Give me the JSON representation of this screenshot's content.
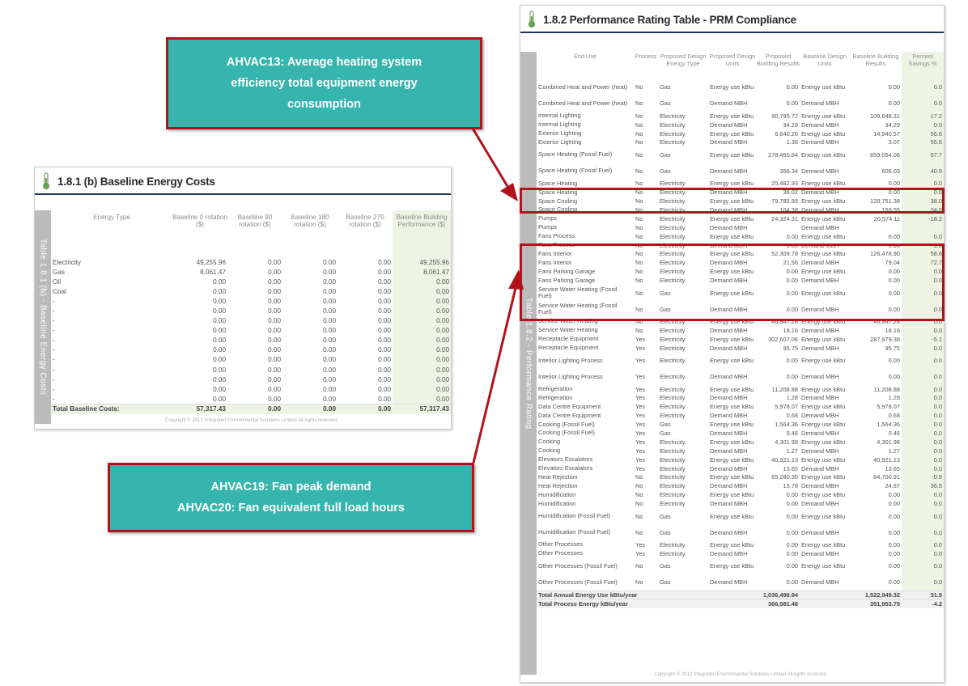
{
  "baseline_panel": {
    "title": "1.8.1 (b) Baseline Energy Costs",
    "side_tab": "Table 1.8.1 (b) - Baseline Energy Costs",
    "headers": [
      "Energy Type",
      "Baseline 0 rotation ($)",
      "Baseline 90 rotation ($)",
      "Baseline 180 rotation ($)",
      "Baseline 270 rotation ($)",
      "Baseline Building Performance ($)"
    ],
    "rows": [
      [
        "Electricity",
        "49,255.96",
        "0.00",
        "0.00",
        "0.00",
        "49,255.96"
      ],
      [
        "Gas",
        "8,061.47",
        "0.00",
        "0.00",
        "0.00",
        "8,061.47"
      ],
      [
        "Oil",
        "0.00",
        "0.00",
        "0.00",
        "0.00",
        "0.00"
      ],
      [
        "Coal",
        "0.00",
        "0.00",
        "0.00",
        "0.00",
        "0.00"
      ],
      [
        "-",
        "0.00",
        "0.00",
        "0.00",
        "0.00",
        "0.00"
      ],
      [
        "-",
        "0.00",
        "0.00",
        "0.00",
        "0.00",
        "0.00"
      ],
      [
        "-",
        "0.00",
        "0.00",
        "0.00",
        "0.00",
        "0.00"
      ],
      [
        "-",
        "0.00",
        "0.00",
        "0.00",
        "0.00",
        "0.00"
      ],
      [
        "-",
        "0.00",
        "0.00",
        "0.00",
        "0.00",
        "0.00"
      ],
      [
        "-",
        "0.00",
        "0.00",
        "0.00",
        "0.00",
        "0.00"
      ],
      [
        "-",
        "0.00",
        "0.00",
        "0.00",
        "0.00",
        "0.00"
      ],
      [
        "-",
        "0.00",
        "0.00",
        "0.00",
        "0.00",
        "0.00"
      ],
      [
        "-",
        "0.00",
        "0.00",
        "0.00",
        "0.00",
        "0.00"
      ],
      [
        "-",
        "0.00",
        "0.00",
        "0.00",
        "0.00",
        "0.00"
      ],
      [
        "-",
        "0.00",
        "0.00",
        "0.00",
        "0.00",
        "0.00"
      ]
    ],
    "total": [
      "Total Baseline Costs:",
      "57,317.43",
      "0.00",
      "0.00",
      "0.00",
      "57,317.43"
    ],
    "copyright": "Copyright © 2012 Integrated Environmental Solutions Limited All rights reserved"
  },
  "prm_panel": {
    "title": "1.8.2 Performance Rating Table - PRM Compliance",
    "side_tab": "Table 1.8.2 - Performance Rating",
    "headers": [
      "End Use",
      "Process",
      "Proposed Design Energy Type",
      "Proposed Design Units",
      "Proposed Building Results",
      "Baseline Design Units",
      "Baseline Building Results",
      "Percent Savings %"
    ],
    "rows": [
      [
        "Combined Heat and Power (heat)",
        "No",
        "Gas",
        "Energy use kBtu",
        "0.00",
        "Energy use kBtu",
        "0.00",
        "0.0"
      ],
      [
        "Combined Heat and Power (heat)",
        "No",
        "Gas",
        "Demand MBH",
        "0.00",
        "Demand MBH",
        "0.00",
        "0.0"
      ],
      [
        "Internal Lighting",
        "No",
        "Electricity",
        "Energy use kBtu",
        "90,795.72",
        "Energy use kBtu",
        "109,648.31",
        "17.2"
      ],
      [
        "Internal Lighting",
        "No",
        "Electricity",
        "Demand MBH",
        "34.29",
        "Demand MBH",
        "34.29",
        "0.0"
      ],
      [
        "Exterior Lighting",
        "No",
        "Electricity",
        "Energy use kBtu",
        "6,640.26",
        "Energy use kBtu",
        "14,940.57",
        "55.6"
      ],
      [
        "Exterior Lighting",
        "No",
        "Electricity",
        "Demand MBH",
        "1.36",
        "Demand MBH",
        "3.07",
        "55.6"
      ],
      [
        "Space Heating (Fossil Fuel)",
        "No",
        "Gas",
        "Energy use kBtu",
        "278,450.84",
        "Energy use kBtu",
        "659,054.06",
        "57.7"
      ],
      [
        "Space Heating (Fossil Fuel)",
        "No",
        "Gas",
        "Demand MBH",
        "358.34",
        "Demand MBH",
        "606.03",
        "40.9"
      ],
      [
        "Space Heating",
        "No",
        "Electricity",
        "Energy use kBtu",
        "25,482.93",
        "Energy use kBtu",
        "0.00",
        "0.0"
      ],
      [
        "Space Heating",
        "No",
        "Electricity",
        "Demand MBH",
        "36.02",
        "Demand MBH",
        "0.00",
        "0.0"
      ],
      [
        "Space Cooling",
        "No",
        "Electricity",
        "Energy use kBtu",
        "79,785.99",
        "Energy use kBtu",
        "128,751.38",
        "38.0"
      ],
      [
        "Space Cooling",
        "No",
        "Electricity",
        "Demand MBH",
        "104.38",
        "Demand MBH",
        "159.55",
        "34.6"
      ],
      [
        "Pumps",
        "No",
        "Electricity",
        "Energy use kBtu",
        "24,324.31",
        "Energy use kBtu",
        "20,574.11",
        "-18.2"
      ],
      [
        "Pumps",
        "No",
        "Electricity",
        "Demand MBH",
        "",
        "Demand MBH",
        "",
        ""
      ],
      [
        "Fans Process",
        "No",
        "Electricity",
        "Energy use kBtu",
        "0.00",
        "Energy use kBtu",
        "0.00",
        "0.0"
      ],
      [
        "Fans Process",
        "No",
        "Electricity",
        "Demand MBH",
        "0.00",
        "Demand MBH",
        "0.00",
        "0.0"
      ],
      [
        "Fans Interior",
        "No",
        "Electricity",
        "Energy use kBtu",
        "52,309.78",
        "Energy use kBtu",
        "126,478.90",
        "58.6"
      ],
      [
        "Fans Interior",
        "No",
        "Electricity",
        "Demand MBH",
        "21.56",
        "Demand MBH",
        "79.04",
        "72.7"
      ],
      [
        "Fans Parking Garage",
        "No",
        "Electricity",
        "Energy use kBtu",
        "0.00",
        "Energy use kBtu",
        "0.00",
        "0.0"
      ],
      [
        "Fans Parking Garage",
        "No",
        "Electricity",
        "Demand MBH",
        "0.00",
        "Demand MBH",
        "0.00",
        "0.0"
      ],
      [
        "Service Water Heating (Fossil Fuel)",
        "No",
        "Gas",
        "Energy use kBtu",
        "0.00",
        "Energy use kBtu",
        "0.00",
        "0.0"
      ],
      [
        "Service Water Heating (Fossil Fuel)",
        "No",
        "Gas",
        "Demand MBH",
        "0.00",
        "Demand MBH",
        "0.00",
        "0.0"
      ],
      [
        "Service Water Heating",
        "No",
        "Electricity",
        "Energy use kBtu",
        "46,847.28",
        "Energy use kBtu",
        "46,847.28",
        "0.0"
      ],
      [
        "Service Water Heating",
        "No",
        "Electricity",
        "Demand MBH",
        "18.16",
        "Demand MBH",
        "18.16",
        "0.0"
      ],
      [
        "Receptacle Equipment",
        "Yes",
        "Electricity",
        "Energy use kBtu",
        "302,607.06",
        "Energy use kBtu",
        "287,979.38",
        "-5.1"
      ],
      [
        "Receptacle Equipment",
        "Yes",
        "Electricity",
        "Demand MBH",
        "95.75",
        "Demand MBH",
        "95.75",
        "0.0"
      ],
      [
        "Interior Lighting Process",
        "Yes",
        "Electricity",
        "Energy use kBtu",
        "0.00",
        "Energy use kBtu",
        "0.00",
        "0.0"
      ],
      [
        "Interior Lighting Process",
        "Yes",
        "Electricity",
        "Demand MBH",
        "0.00",
        "Demand MBH",
        "0.00",
        "0.0"
      ],
      [
        "Refrigeration",
        "Yes",
        "Electricity",
        "Energy use kBtu",
        "11,208.88",
        "Energy use kBtu",
        "11,208.88",
        "0.0"
      ],
      [
        "Refrigeration",
        "Yes",
        "Electricity",
        "Demand MBH",
        "1.28",
        "Demand MBH",
        "1.28",
        "0.0"
      ],
      [
        "Data Centre Equipment",
        "Yes",
        "Electricity",
        "Energy use kBtu",
        "5,978.07",
        "Energy use kBtu",
        "5,978.07",
        "0.0"
      ],
      [
        "Data Centre Equipment",
        "Yes",
        "Electricity",
        "Demand MBH",
        "0.68",
        "Demand MBH",
        "0.68",
        "0.0"
      ],
      [
        "Cooking (Fossil Fuel)",
        "Yes",
        "Gas",
        "Energy use kBtu",
        "1,564.36",
        "Energy use kBtu",
        "1,564.36",
        "0.0"
      ],
      [
        "Cooking (Fossil Fuel)",
        "Yes",
        "Gas",
        "Demand MBH",
        "0.46",
        "Demand MBH",
        "0.46",
        "0.0"
      ],
      [
        "Cooking",
        "Yes",
        "Electricity",
        "Energy use kBtu",
        "4,301.98",
        "Energy use kBtu",
        "4,301.98",
        "0.0"
      ],
      [
        "Cooking",
        "Yes",
        "Electricity",
        "Demand MBH",
        "1.27",
        "Demand MBH",
        "1.27",
        "0.0"
      ],
      [
        "Elevators Escalators",
        "Yes",
        "Electricity",
        "Energy use kBtu",
        "40,921.13",
        "Energy use kBtu",
        "40,921.13",
        "0.0"
      ],
      [
        "Elevators Escalators",
        "Yes",
        "Electricity",
        "Demand MBH",
        "13.65",
        "Demand MBH",
        "13.65",
        "0.0"
      ],
      [
        "Heat Rejection",
        "No",
        "Electricity",
        "Energy use kBtu",
        "65,280.35",
        "Energy use kBtu",
        "64,700.91",
        "-0.9"
      ],
      [
        "Heat Rejection",
        "No",
        "Electricity",
        "Demand MBH",
        "15.78",
        "Demand MBH",
        "24.87",
        "36.5"
      ],
      [
        "Humidification",
        "No",
        "Electricity",
        "Energy use kBtu",
        "0.00",
        "Energy use kBtu",
        "0.00",
        "0.0"
      ],
      [
        "Humidification",
        "No",
        "Electricity",
        "Demand MBH",
        "0.00",
        "Demand MBH",
        "0.00",
        "0.0"
      ],
      [
        "Humidification (Fossil Fuel)",
        "No",
        "Gas",
        "Energy use kBtu",
        "0.00",
        "Energy use kBtu",
        "0.00",
        "0.0"
      ],
      [
        "Humidification (Fossil Fuel)",
        "No",
        "Gas",
        "Demand MBH",
        "0.00",
        "Demand MBH",
        "0.00",
        "0.0"
      ],
      [
        "Other Processes",
        "Yes",
        "Electricity",
        "Energy use kBtu",
        "0.00",
        "Energy use kBtu",
        "0.00",
        "0.0"
      ],
      [
        "Other Processes",
        "Yes",
        "Electricity",
        "Demand MBH",
        "0.00",
        "Demand MBH",
        "0.00",
        "0.0"
      ],
      [
        "Other Processes (Fossil Fuel)",
        "No",
        "Gas",
        "Energy use kBtu",
        "0.00",
        "Energy use kBtu",
        "0.00",
        "0.0"
      ],
      [
        "Other Processes (Fossil Fuel)",
        "No",
        "Gas",
        "Demand MBH",
        "0.00",
        "Demand MBH",
        "0.00",
        "0.0"
      ]
    ],
    "totals": [
      {
        "label": "Total Annual Energy Use kBtu/year",
        "proposed": "1,036,498.94",
        "baseline": "1,522,949.32",
        "savings": "31.9"
      },
      {
        "label": "Total Process Energy kBtu/year",
        "proposed": "366,581.48",
        "baseline": "351,953.79",
        "savings": "-4.2"
      }
    ],
    "copyright": "Copyright © 2012 Integrated Environmental Solutions Limited All rights reserved"
  },
  "callouts": {
    "heating": [
      "AHVAC13: Average heating system",
      "efficiency total equipment energy",
      "consumption"
    ],
    "fans": [
      "AHVAC19: Fan peak demand",
      "AHVAC20: Fan equivalent full load hours"
    ]
  },
  "colors": {
    "callout_fill": "#35b5ad",
    "highlight": "#b0141a",
    "header_rule": "#1f3550",
    "savings_column": "#eef4e4"
  }
}
